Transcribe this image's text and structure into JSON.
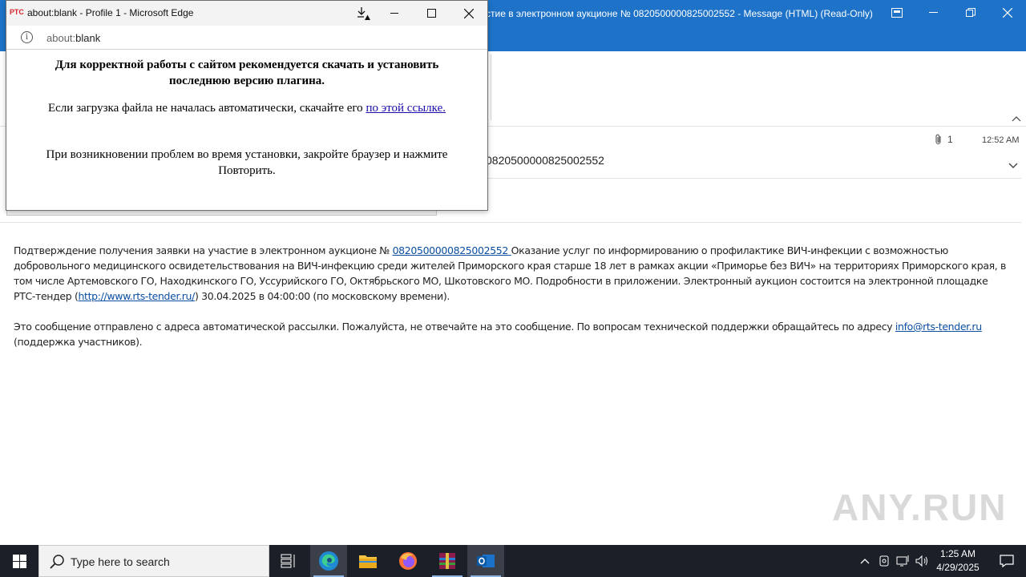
{
  "outlook": {
    "window_title": "стие в электронном аукционе № 0820500000825002552  -  Message (HTML) (Read-Only)",
    "subject": "0820500000825002552",
    "attachment_count": "1",
    "time": "12:52 AM",
    "body": {
      "p1_a": "Подтверждение получения заявки на участие в электронном аукционе № ",
      "p1_link": "0820500000825002552 ",
      "p1_b": " Оказание услуг по информированию о профилактике ВИЧ-инфекции с возможностью добровольного медицинского освидетельствования на ВИЧ-инфекцию среди жителей Приморского края старше 18 лет в рамках акции «Приморье без ВИЧ» на территориях Приморского края, в том числе Артемовского ГО, Находкинского ГО, Уссурийского ГО, Октябрьского МО, Шкотовского МО. Подробности в приложении. Электронный аукцион состоится на электронной площадке РТС-тендер (",
      "p1_url": "http://www.rts-tender.ru/",
      "p1_c": ") 30.04.2025  в 04:00:00  (по московскому времени).",
      "p2_a": "Это сообщение отправлено с адреса автоматической рассылки. Пожалуйста, не отвечайте на это сообщение. По вопросам технической поддержки обращайтесь по адресу ",
      "p2_email": "info@rts-tender.ru",
      "p2_b": " (поддержка участников)."
    }
  },
  "edge": {
    "favicon_text": "РТС",
    "window_title": "about:blank - Profile 1 - Microsoft Edge",
    "address_dim": "about:",
    "address_rest": "blank",
    "heading": "Для корректной работы с сайтом рекомендуется скачать и установить последнюю версию плагина.",
    "p1_text": "Если загрузка файла не началась автоматически, скачайте его ",
    "p1_link": "по этой ссылке.",
    "p2_text": "При возникновении проблем во время установки, закройте браузер и нажмите Повторить."
  },
  "watermark": "ANY.RUN",
  "taskbar": {
    "search_placeholder": "Type here to search",
    "time": "1:25 AM",
    "date": "4/29/2025"
  },
  "colors": {
    "outlook_blue": "#1e73c8",
    "taskbar_bg": "#1b1f27",
    "link": "#0b4ea2"
  }
}
